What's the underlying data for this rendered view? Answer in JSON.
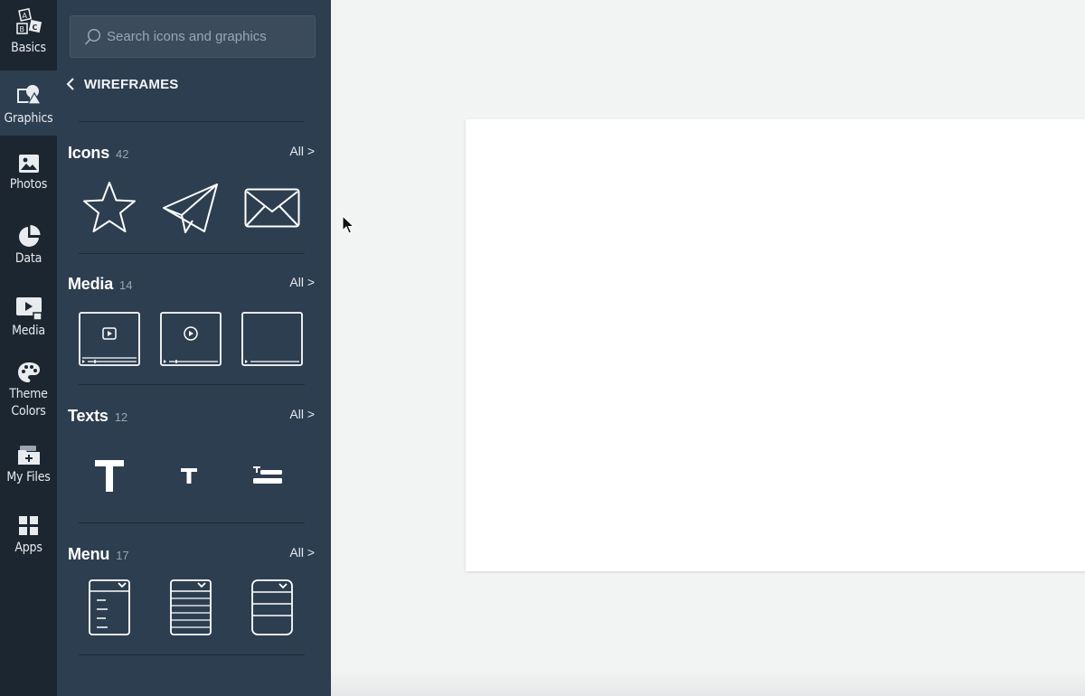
{
  "rail": {
    "items": [
      {
        "label": "Basics",
        "icon": "abc-blocks-icon"
      },
      {
        "label": "Graphics",
        "icon": "shapes-icon"
      },
      {
        "label": "Photos",
        "icon": "image-icon"
      },
      {
        "label": "Data",
        "icon": "pie-chart-icon"
      },
      {
        "label": "Media",
        "icon": "video-icon"
      },
      {
        "label": "Theme\nColors",
        "icon": "palette-icon"
      },
      {
        "label": "My Files",
        "icon": "folder-icon"
      },
      {
        "label": "Apps",
        "icon": "apps-grid-icon"
      }
    ],
    "active": "Graphics"
  },
  "panel": {
    "search_placeholder": "Search icons and graphics",
    "back_label": "WIREFRAMES",
    "sections": [
      {
        "name": "Icons",
        "count": "42",
        "all_label": "All >"
      },
      {
        "name": "Media",
        "count": "14",
        "all_label": "All >"
      },
      {
        "name": "Texts",
        "count": "12",
        "all_label": "All >"
      },
      {
        "name": "Menu",
        "count": "17",
        "all_label": "All >"
      }
    ]
  },
  "colors": {
    "rail_bg": "#1c2631",
    "panel_bg": "#2d3e50",
    "canvas_bg": "#ffffff",
    "workspace_bg": "#f2f3f3"
  }
}
